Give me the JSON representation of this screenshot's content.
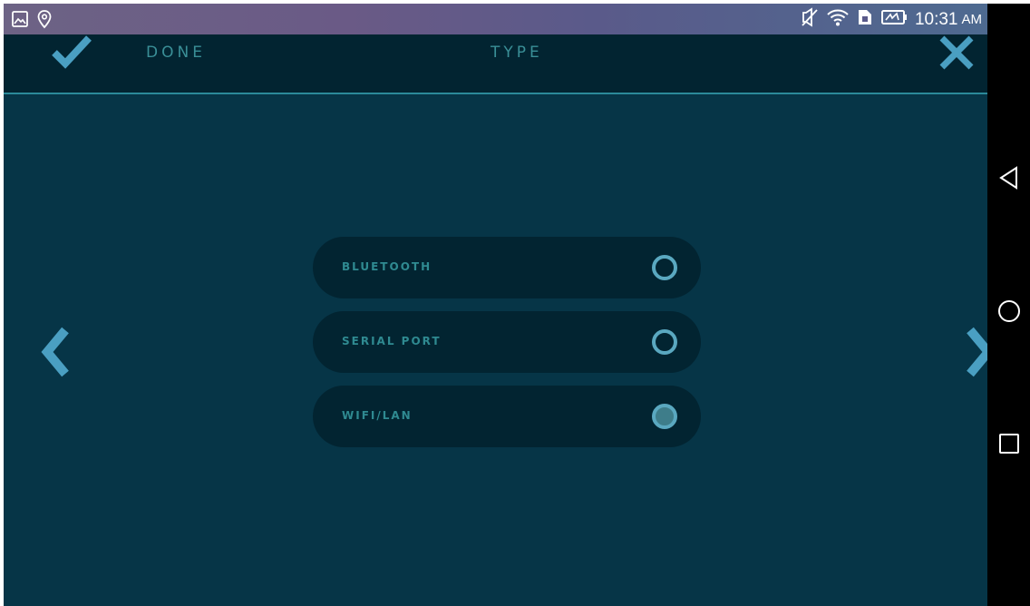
{
  "status_bar": {
    "left_icons": [
      "image-icon",
      "location-icon"
    ],
    "right_icons": [
      "mute-icon",
      "wifi-icon",
      "sim-icon",
      "battery-charging-icon"
    ],
    "time": "10:31",
    "ampm": "AM"
  },
  "header": {
    "done_label": "DONE",
    "title": "TYPE"
  },
  "options": [
    {
      "label": "BLUETOOTH",
      "selected": false
    },
    {
      "label": "SERIAL PORT",
      "selected": false
    },
    {
      "label": "WIFI/LAN",
      "selected": true
    }
  ],
  "colors": {
    "background": "#063547",
    "header": "#022431",
    "accent": "#3a8f97",
    "icon_accent": "#4a9fc2",
    "radio": "#5aa8c0"
  },
  "android_nav": [
    "back-icon",
    "home-icon",
    "recents-icon"
  ]
}
